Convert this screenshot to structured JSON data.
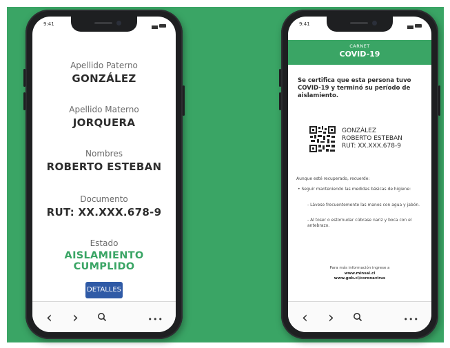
{
  "colors": {
    "accent_green": "#3aa565",
    "button_blue": "#2f5aa6"
  },
  "left_phone": {
    "status_time": "9:41",
    "fields": [
      {
        "label": "Apellido Paterno",
        "value": "GONZÁLEZ"
      },
      {
        "label": "Apellido Materno",
        "value": "JORQUERA"
      },
      {
        "label": "Nombres",
        "value": "ROBERTO ESTEBAN"
      },
      {
        "label": "Documento",
        "value": "RUT: XX.XXX.678-9"
      },
      {
        "label": "Estado",
        "value": "AISLAMIENTO CUMPLIDO"
      }
    ],
    "details_button": "DETALLES",
    "nav": {
      "back": "‹",
      "forward": "›",
      "search": "⚲",
      "more": "•••"
    }
  },
  "right_phone": {
    "status_time": "9:41",
    "header": {
      "small": "CARNET",
      "big": "COVID-19"
    },
    "certification": "Se certifica que esta persona tuvo COVID-19 y terminó su período de aislamiento.",
    "qr_info": {
      "surname": "GONZÁLEZ",
      "names": "ROBERTO ESTEBAN",
      "rut": "RUT: XX.XXX.678-9"
    },
    "remember_intro": "Aunque esté recuperado, recuerde:",
    "bullets": {
      "main": "• Seguir manteniendo las medidas básicas de higiene:",
      "sub1": "- Lávese frecuentemente las manos con agua y jabón.",
      "sub2": "- Al toser o estornudar cúbrase nariz y boca con el antebrazo."
    },
    "footer": {
      "intro": "Para más información ingrese a",
      "link1": "www.minsal.cl",
      "link2": "www.gob.cl/coronavirus"
    },
    "nav": {
      "back": "‹",
      "forward": "›",
      "search": "⚲",
      "more": "•••"
    }
  }
}
